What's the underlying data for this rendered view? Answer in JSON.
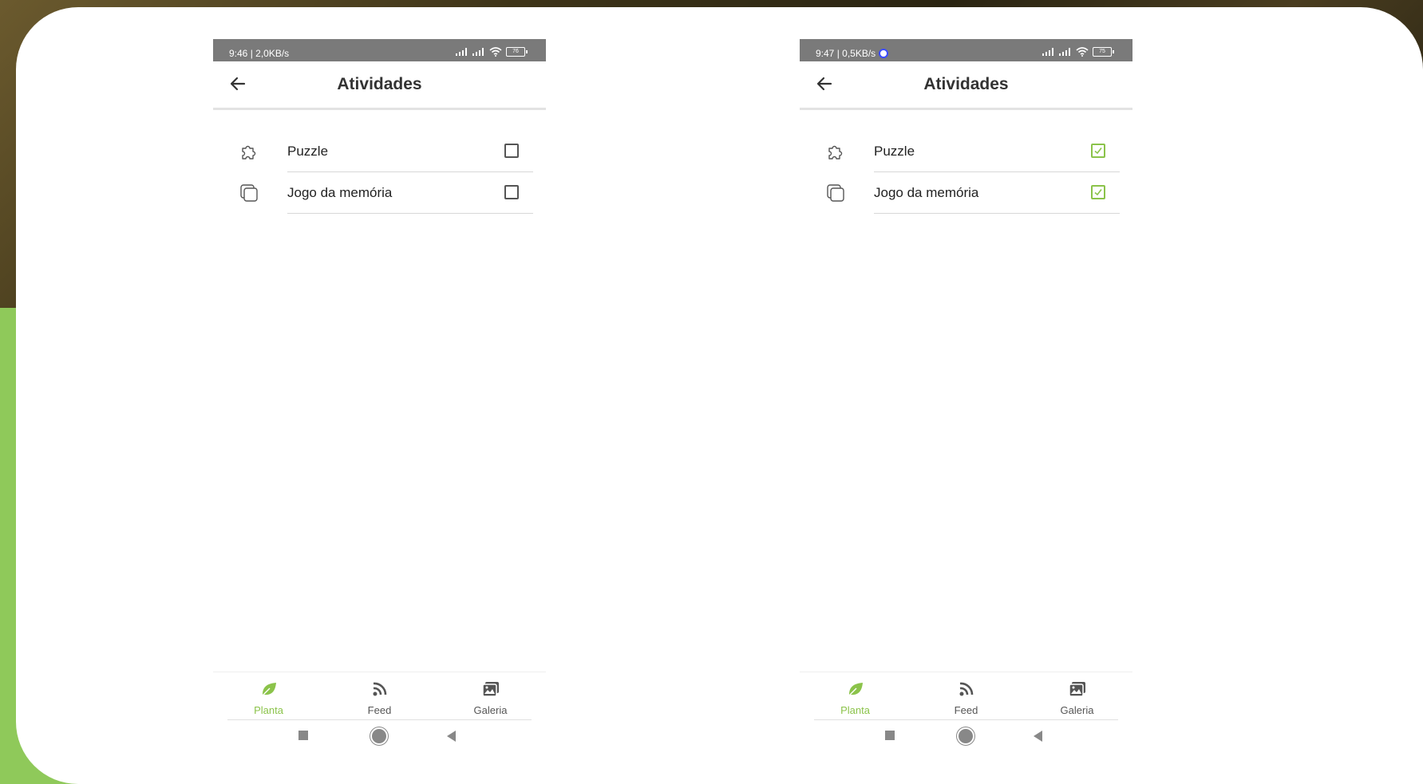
{
  "colors": {
    "accent": "#8bc34a",
    "background_green": "#8fc95a",
    "status_bar": "#7a7a7a",
    "card": "#ffffff"
  },
  "screens": [
    {
      "status": {
        "text": "9:46 | 2,0KB/s",
        "battery": "76",
        "sync_indicator": false
      },
      "title": "Atividades",
      "items": [
        {
          "label": "Puzzle",
          "icon": "puzzle-icon",
          "checked": false
        },
        {
          "label": "Jogo da memória",
          "icon": "copy-cards-icon",
          "checked": false
        }
      ],
      "nav": [
        {
          "label": "Planta",
          "icon": "leaf-icon",
          "active": true
        },
        {
          "label": "Feed",
          "icon": "rss-feed-icon",
          "active": false
        },
        {
          "label": "Galeria",
          "icon": "gallery-icon",
          "active": false
        }
      ]
    },
    {
      "status": {
        "text": "9:47 | 0,5KB/s",
        "battery": "75",
        "sync_indicator": true
      },
      "title": "Atividades",
      "items": [
        {
          "label": "Puzzle",
          "icon": "puzzle-icon",
          "checked": true
        },
        {
          "label": "Jogo da memória",
          "icon": "copy-cards-icon",
          "checked": true
        }
      ],
      "nav": [
        {
          "label": "Planta",
          "icon": "leaf-icon",
          "active": true
        },
        {
          "label": "Feed",
          "icon": "rss-feed-icon",
          "active": false
        },
        {
          "label": "Galeria",
          "icon": "gallery-icon",
          "active": false
        }
      ]
    }
  ]
}
